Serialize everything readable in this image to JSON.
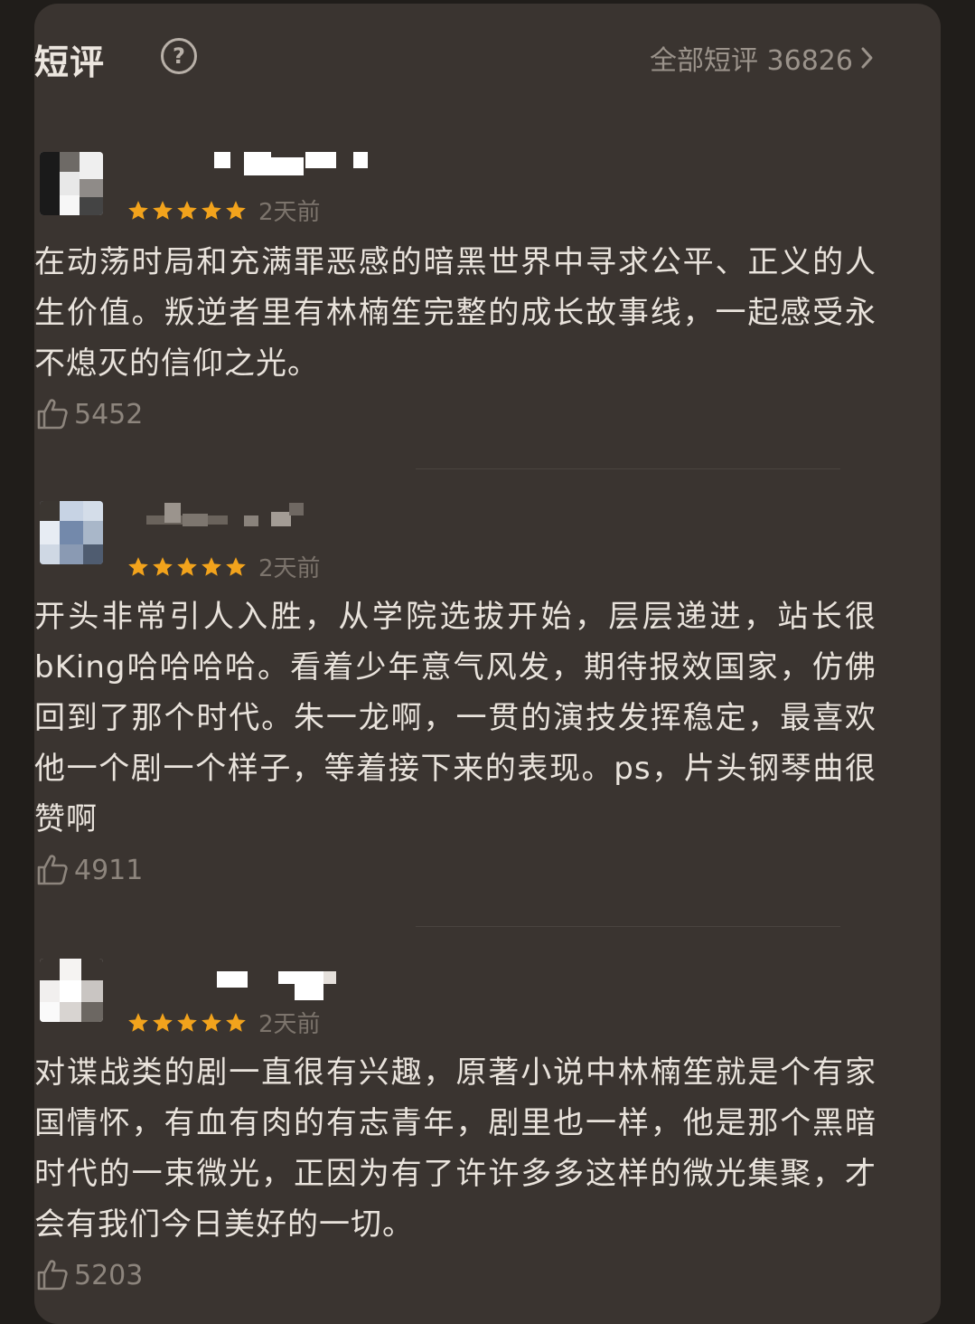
{
  "header": {
    "title": "短评",
    "help_icon": "?",
    "all_reviews_label": "全部短评 36826"
  },
  "colors": {
    "star": "#f2a31c",
    "background": "#3a3430",
    "text": "#e9e3dc"
  },
  "reviews": [
    {
      "rating": 5,
      "date": "2天前",
      "text": "在动荡时局和充满罪恶感的暗黑世界中寻求公平、正义的人生价值。叛逆者里有林楠笙完整的成长故事线，一起感受永不熄灭的信仰之光。",
      "likes": "5452"
    },
    {
      "rating": 5,
      "date": "2天前",
      "text": "开头非常引人入胜，从学院选拔开始，层层递进，站长很bKing哈哈哈哈。看着少年意气风发，期待报效国家，仿佛回到了那个时代。朱一龙啊，一贯的演技发挥稳定，最喜欢他一个剧一个样子，等着接下来的表现。ps，片头钢琴曲很赞啊",
      "likes": "4911"
    },
    {
      "rating": 5,
      "date": "2天前",
      "text": "对谍战类的剧一直很有兴趣，原著小说中林楠笙就是个有家国情怀，有血有肉的有志青年，剧里也一样，他是那个黑暗时代的一束微光，正因为有了许许多多这样的微光集聚，才会有我们今日美好的一切。",
      "likes": "5203"
    }
  ]
}
